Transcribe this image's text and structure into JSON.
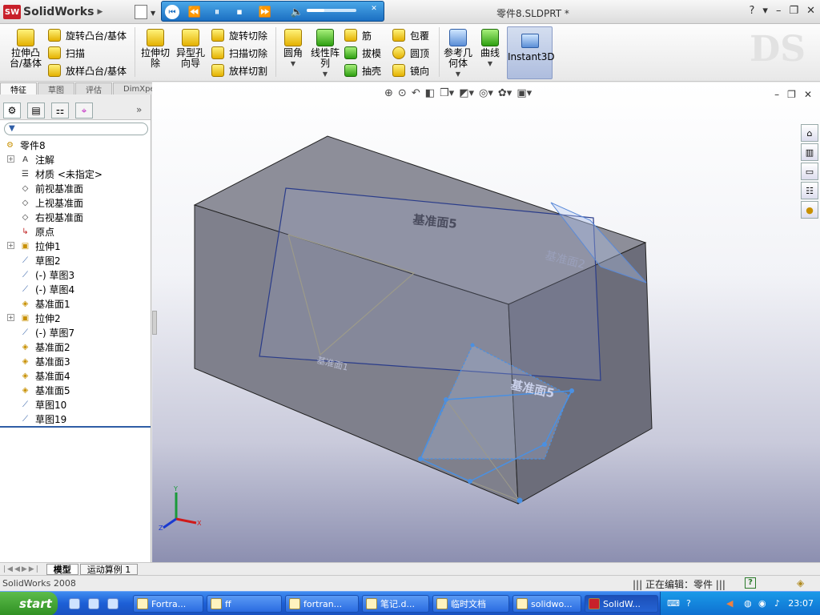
{
  "app": {
    "name": "SolidWorks",
    "document_title": "零件8.SLDPRT *"
  },
  "ribbon": {
    "extruded_boss": "拉伸凸台/基体",
    "revolved_boss": "旋转凸台/基体",
    "swept_boss": "扫描",
    "lofted_boss": "放样凸台/基体",
    "extruded_cut": "拉伸切除",
    "hole_wizard": "异型孔向导",
    "revolved_cut": "旋转切除",
    "swept_cut": "扫描切除",
    "lofted_cut": "放样切割",
    "fillet": "圆角",
    "linear_pattern": "线性阵列",
    "rib": "筋",
    "draft": "拔模",
    "shell": "抽壳",
    "wrap": "包覆",
    "dome": "圆顶",
    "mirror": "镜向",
    "ref_geometry": "参考几何体",
    "curves": "曲线",
    "instant3d": "Instant3D"
  },
  "command_tabs": [
    "特征",
    "草图",
    "评估",
    "DimXpert"
  ],
  "tree": {
    "root": "零件8",
    "items": [
      {
        "label": "注解",
        "type": "annotation"
      },
      {
        "label": "材质 <未指定>",
        "type": "material"
      },
      {
        "label": "前视基准面",
        "type": "plane"
      },
      {
        "label": "上视基准面",
        "type": "plane"
      },
      {
        "label": "右视基准面",
        "type": "plane"
      },
      {
        "label": "原点",
        "type": "origin"
      },
      {
        "label": "拉伸1",
        "type": "feature"
      },
      {
        "label": "草图2",
        "type": "sketch"
      },
      {
        "label": "(-) 草图3",
        "type": "sketch"
      },
      {
        "label": "(-) 草图4",
        "type": "sketch"
      },
      {
        "label": "基准面1",
        "type": "refplane"
      },
      {
        "label": "拉伸2",
        "type": "feature"
      },
      {
        "label": "(-) 草图7",
        "type": "sketch"
      },
      {
        "label": "基准面2",
        "type": "refplane"
      },
      {
        "label": "基准面3",
        "type": "refplane"
      },
      {
        "label": "基准面4",
        "type": "refplane"
      },
      {
        "label": "基准面5",
        "type": "refplane"
      },
      {
        "label": "草图10",
        "type": "sketch"
      },
      {
        "label": "草图19",
        "type": "sketch"
      }
    ]
  },
  "bottom_tabs": [
    "模型",
    "运动算例 1"
  ],
  "viewport_labels": {
    "plane5a": "基准面5",
    "plane2": "基准面2",
    "plane5b": "基准面5",
    "plane_small": "基准面1"
  },
  "status": {
    "left": "SolidWorks 2008",
    "right": "正在编辑：零件"
  },
  "taskbar": {
    "start": "start",
    "tasks": [
      "Fortra...",
      "ff",
      "fortran...",
      "笔记.d...",
      "临时文档",
      "solidwo...",
      "SolidW..."
    ],
    "clock": "23:07"
  },
  "colors": {
    "accent": "#1b6fc2",
    "selection": "#2f5ea6"
  }
}
